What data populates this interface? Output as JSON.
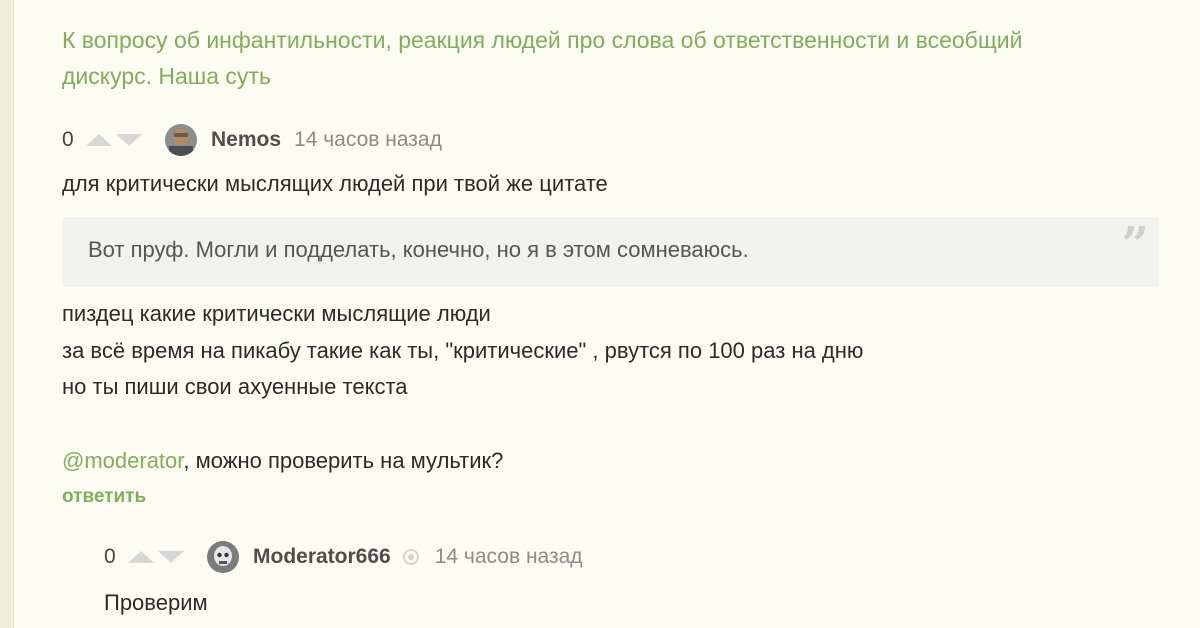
{
  "story": {
    "title": "К вопросу об инфантильности, реакция людей про слова об ответственности и всеобщий дискурс. Наша суть"
  },
  "comment": {
    "rating": "0",
    "username": "Nemos",
    "time": "14 часов назад",
    "intro": "для критически мыслящих людей при твой же цитате",
    "quote": "Вот пруф. Могли и подделать, конечно, но я в этом сомневаюсь.",
    "lines": [
      "пиздец какие критически мыслящие люди",
      "за всё время на пикабу такие как ты, \"критические\" , рвутся по 100 раз на дню",
      "но ты пиши свои ахуенные текста"
    ],
    "mention": "@moderator",
    "mention_rest": ", можно проверить на мультик?",
    "reply_label": "ответить"
  },
  "reply": {
    "rating": "0",
    "username": "Moderator666",
    "time": "14 часов назад",
    "text": "Проверим"
  },
  "colors": {
    "link_green": "#7fae5a",
    "background": "#fdfcf3",
    "quote_bg": "#f1f1f0"
  },
  "icons": {
    "vote_up": "triangle-up-icon",
    "vote_down": "triangle-down-icon",
    "moderator_badge": "moderator-badge-icon",
    "quote": "quote-mark-icon"
  }
}
